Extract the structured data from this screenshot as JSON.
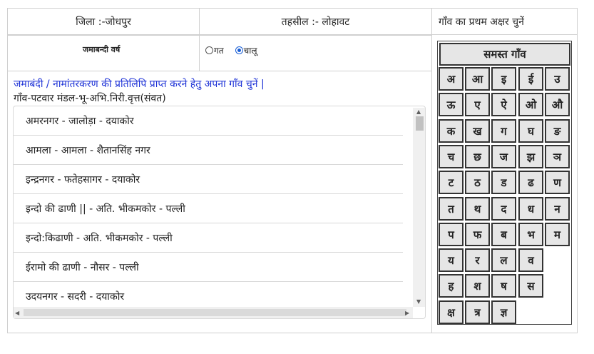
{
  "header": {
    "district": "जिला :-जोधपुर",
    "tehsil": "तहसील :- लोहावट",
    "choose_letter": "गाँव का प्रथम अक्षर चुनें"
  },
  "year_section": {
    "label": "जमाबन्दी वर्ष",
    "options": [
      {
        "label": "गत",
        "selected": false
      },
      {
        "label": "चालू",
        "selected": true
      }
    ]
  },
  "instruction": "जमाबंदी / नामांतरकरण की प्रतिलिपि प्राप्त करने हेतु अपना गाँव चुनें |",
  "list_header": "गाँव-पटवार मंडल-भू-अभि.निरी.वृत्त(संवत)",
  "villages": [
    "अमरनगर - जालोड़ा - दयाकोर",
    "आमला - आमला - शैतानसिंह नगर",
    "इन्द्रनगर - फतेहसागर - दयाकोर",
    "इन्दो की ढाणी || - अति. भीकमकोर - पल्ली",
    "इन्दो:किढाणी - अति. भीकमकोर - पल्ली",
    "ईरामो की ढाणी - नौसर - पल्ली",
    "उदयनगर - सदरी - दयाकोर"
  ],
  "letters_panel": {
    "all_villages": "समस्त गाँव",
    "rows": [
      [
        "अ",
        "आ",
        "इ",
        "ई",
        "उ"
      ],
      [
        "ऊ",
        "ए",
        "ऐ",
        "ओ",
        "औ"
      ],
      [
        "क",
        "ख",
        "ग",
        "घ",
        "ङ"
      ],
      [
        "च",
        "छ",
        "ज",
        "झ",
        "ञ"
      ],
      [
        "ट",
        "ठ",
        "ड",
        "ढ",
        "ण"
      ],
      [
        "त",
        "थ",
        "द",
        "ध",
        "न"
      ],
      [
        "प",
        "फ",
        "ब",
        "भ",
        "म"
      ],
      [
        "य",
        "र",
        "ल",
        "व"
      ],
      [
        "ह",
        "श",
        "ष",
        "स"
      ],
      [
        "क्ष",
        "त्र",
        "ज्ञ"
      ]
    ]
  },
  "colors": {
    "instruction_text": "#1a2fd6",
    "radio_selected": "#1a5fd6",
    "key_bg": "#e6e6e6"
  }
}
